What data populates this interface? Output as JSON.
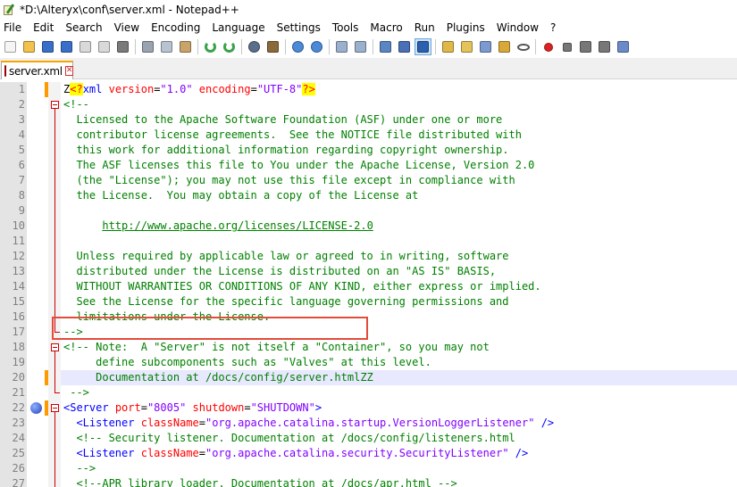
{
  "window": {
    "title": "*D:\\Alteryx\\conf\\server.xml - Notepad++"
  },
  "menu": [
    "File",
    "Edit",
    "Search",
    "View",
    "Encoding",
    "Language",
    "Settings",
    "Tools",
    "Macro",
    "Run",
    "Plugins",
    "Window",
    "?"
  ],
  "toolbar": {
    "icons": [
      "new-file-icon",
      "open-file-icon",
      "save-icon",
      "save-all-icon",
      "close-icon",
      "close-all-icon",
      "print-icon",
      "|",
      "cut-icon",
      "copy-icon",
      "paste-icon",
      "|",
      "undo-icon",
      "redo-icon",
      "|",
      "find-icon",
      "replace-icon",
      "|",
      "zoom-in-icon",
      "zoom-out-icon",
      "|",
      "sync-vertical-icon",
      "sync-horizontal-icon",
      "|",
      "word-wrap-icon",
      "show-all-chars-icon",
      "indent-guide-icon",
      "|",
      "user-language-icon",
      "document-map-icon",
      "function-list-icon",
      "folder-workspace-icon",
      "monitoring-icon",
      "|",
      "record-macro-icon",
      "stop-macro-icon",
      "play-macro-icon",
      "run-macro-multiple-icon",
      "save-macro-icon"
    ],
    "active_icon": "indent-guide-icon"
  },
  "tab": {
    "label": "server.xml"
  },
  "editor": {
    "current_line": 20,
    "bookmark_line": 22,
    "lines": [
      {
        "n": "1",
        "parts": [
          [
            "plain",
            "Z"
          ],
          [
            "pi",
            "<?"
          ],
          [
            "tag",
            "xml"
          ],
          [
            "plain",
            " "
          ],
          [
            "attr",
            "version"
          ],
          [
            "plain",
            "="
          ],
          [
            "val",
            "\"1.0\""
          ],
          [
            "plain",
            " "
          ],
          [
            "attr",
            "encoding"
          ],
          [
            "plain",
            "="
          ],
          [
            "val",
            "\"UTF-8\""
          ],
          [
            "pi",
            "?>"
          ]
        ]
      },
      {
        "n": "2",
        "parts": [
          [
            "cmt",
            "<!--"
          ]
        ]
      },
      {
        "n": "3",
        "parts": [
          [
            "cmt",
            "  Licensed to the Apache Software Foundation (ASF) under one or more"
          ]
        ]
      },
      {
        "n": "4",
        "parts": [
          [
            "cmt",
            "  contributor license agreements.  See the NOTICE file distributed with"
          ]
        ]
      },
      {
        "n": "5",
        "parts": [
          [
            "cmt",
            "  this work for additional information regarding copyright ownership."
          ]
        ]
      },
      {
        "n": "6",
        "parts": [
          [
            "cmt",
            "  The ASF licenses this file to You under the Apache License, Version 2.0"
          ]
        ]
      },
      {
        "n": "7",
        "parts": [
          [
            "cmt",
            "  (the \"License\"); you may not use this file except in compliance with"
          ]
        ]
      },
      {
        "n": "8",
        "parts": [
          [
            "cmt",
            "  the License.  You may obtain a copy of the License at"
          ]
        ]
      },
      {
        "n": "9",
        "parts": [
          [
            "cmt",
            ""
          ]
        ]
      },
      {
        "n": "10",
        "parts": [
          [
            "cmt",
            "      "
          ],
          [
            "url",
            "http://www.apache.org/licenses/LICENSE-2.0"
          ]
        ]
      },
      {
        "n": "11",
        "parts": [
          [
            "cmt",
            ""
          ]
        ]
      },
      {
        "n": "12",
        "parts": [
          [
            "cmt",
            "  Unless required by applicable law or agreed to in writing, software"
          ]
        ]
      },
      {
        "n": "13",
        "parts": [
          [
            "cmt",
            "  distributed under the License is distributed on an \"AS IS\" BASIS,"
          ]
        ]
      },
      {
        "n": "14",
        "parts": [
          [
            "cmt",
            "  WITHOUT WARRANTIES OR CONDITIONS OF ANY KIND, either express or implied."
          ]
        ]
      },
      {
        "n": "15",
        "parts": [
          [
            "cmt",
            "  See the License for the specific language governing permissions and"
          ]
        ]
      },
      {
        "n": "16",
        "parts": [
          [
            "cmt",
            "  limitations under the License."
          ]
        ]
      },
      {
        "n": "17",
        "parts": [
          [
            "cmt",
            "-->"
          ]
        ]
      },
      {
        "n": "18",
        "parts": [
          [
            "cmt",
            "<!-- Note:  A \"Server\" is not itself a \"Container\", so you may not"
          ]
        ]
      },
      {
        "n": "19",
        "parts": [
          [
            "cmt",
            "     define subcomponents such as \"Valves\" at this level."
          ]
        ]
      },
      {
        "n": "20",
        "parts": [
          [
            "cmt",
            "     Documentation at /docs/config/server.htmlZZ"
          ]
        ]
      },
      {
        "n": "21",
        "parts": [
          [
            "cmt",
            " -->"
          ]
        ]
      },
      {
        "n": "22",
        "parts": [
          [
            "tag",
            "<Server"
          ],
          [
            "plain",
            " "
          ],
          [
            "attr",
            "port"
          ],
          [
            "plain",
            "="
          ],
          [
            "val",
            "\"8005\""
          ],
          [
            "plain",
            " "
          ],
          [
            "attr",
            "shutdown"
          ],
          [
            "plain",
            "="
          ],
          [
            "val",
            "\"SHUTDOWN\""
          ],
          [
            "tag",
            ">"
          ]
        ]
      },
      {
        "n": "23",
        "parts": [
          [
            "plain",
            "  "
          ],
          [
            "tag",
            "<Listener"
          ],
          [
            "plain",
            " "
          ],
          [
            "attr",
            "className"
          ],
          [
            "plain",
            "="
          ],
          [
            "val",
            "\"org.apache.catalina.startup.VersionLoggerListener\""
          ],
          [
            "plain",
            " "
          ],
          [
            "tag",
            "/>"
          ]
        ]
      },
      {
        "n": "24",
        "parts": [
          [
            "plain",
            "  "
          ],
          [
            "cmt",
            "<!-- Security listener. Documentation at /docs/config/listeners.html"
          ]
        ]
      },
      {
        "n": "25",
        "parts": [
          [
            "plain",
            "  "
          ],
          [
            "tag",
            "<Listener"
          ],
          [
            "plain",
            " "
          ],
          [
            "attr",
            "className"
          ],
          [
            "plain",
            "="
          ],
          [
            "val",
            "\"org.apache.catalina.security.SecurityListener\""
          ],
          [
            "plain",
            " "
          ],
          [
            "tag",
            "/>"
          ]
        ]
      },
      {
        "n": "26",
        "parts": [
          [
            "cmt",
            "  -->"
          ]
        ]
      },
      {
        "n": "27",
        "parts": [
          [
            "plain",
            "  "
          ],
          [
            "cmt",
            "<!--APR library loader. Documentation at /docs/apr.html -->"
          ]
        ]
      }
    ]
  }
}
